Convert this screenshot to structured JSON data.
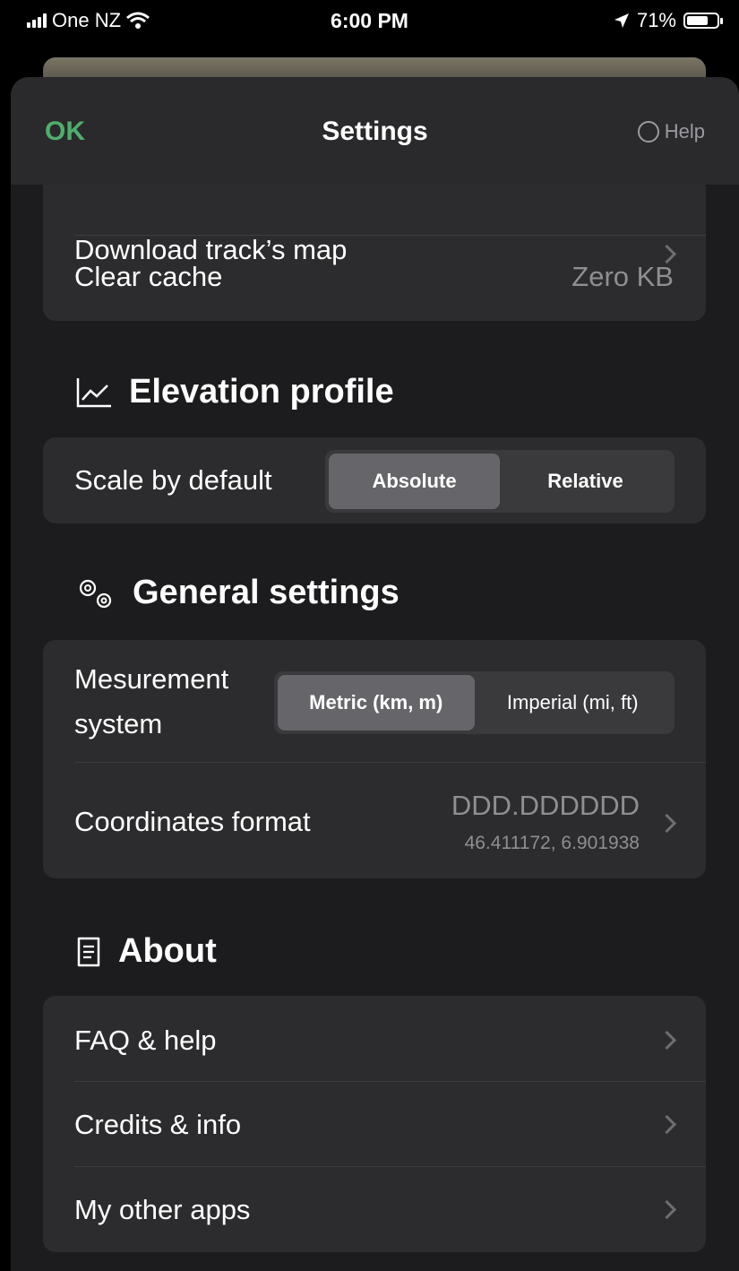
{
  "status_bar": {
    "carrier": "One NZ",
    "time": "6:00 PM",
    "battery_percent": "71%",
    "battery_level": 0.71
  },
  "nav": {
    "ok_label": "OK",
    "title": "Settings",
    "help_label": "Help"
  },
  "map_group": {
    "download_label": "Download track’s map",
    "clear_cache_label": "Clear cache",
    "clear_cache_value": "Zero KB"
  },
  "elevation": {
    "header": "Elevation profile",
    "icon": "chart-icon",
    "scale_label": "Scale by default",
    "options": [
      "Absolute",
      "Relative"
    ],
    "selected": "Absolute"
  },
  "general": {
    "header": "General settings",
    "icon": "gears-icon",
    "measurement_label_line1": "Mesurement",
    "measurement_label_line2": "system",
    "measurement_options": [
      "Metric (km, m)",
      "Imperial (mi, ft)"
    ],
    "measurement_selected": "Metric (km, m)",
    "coordinates_label": "Coordinates format",
    "coordinates_value": "DDD.DDDDDD",
    "coordinates_example": "46.411172, 6.901938"
  },
  "about": {
    "header": "About",
    "icon": "document-icon",
    "items": [
      {
        "label": "FAQ & help"
      },
      {
        "label": "Credits & info"
      },
      {
        "label": "My other apps"
      }
    ]
  },
  "colors": {
    "accent_ok": "#4fae6b",
    "background": "#1c1c1e",
    "card": "#2c2c2e"
  }
}
